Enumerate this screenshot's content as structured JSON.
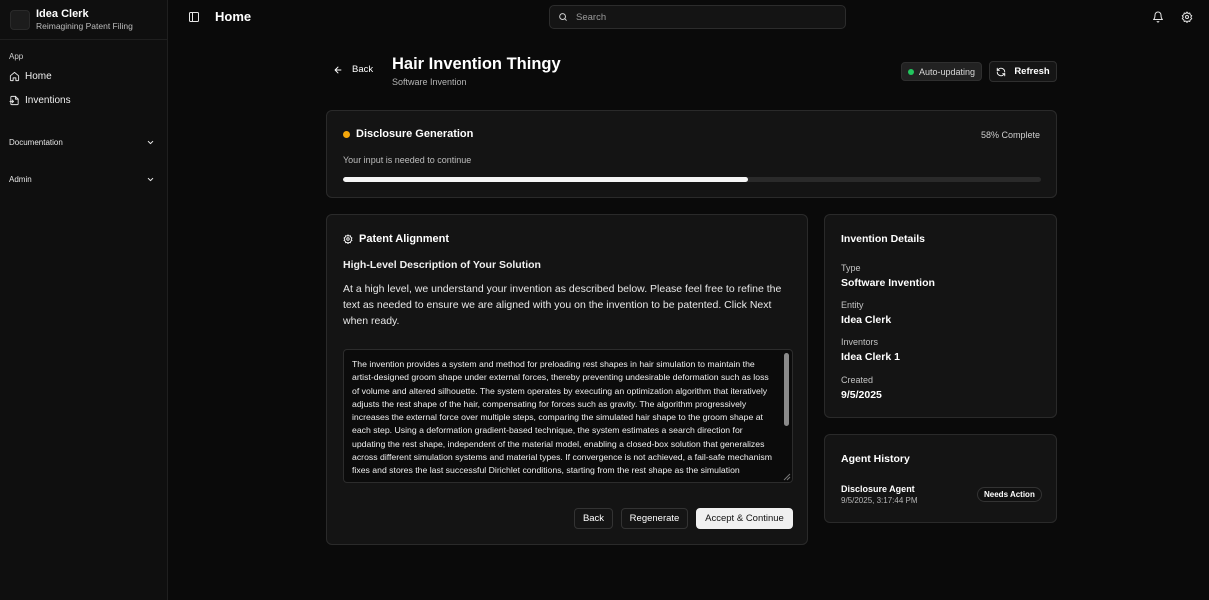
{
  "sidebar": {
    "brand_title": "Idea Clerk",
    "brand_subtitle": "Reimagining Patent Filing",
    "group_app": "App",
    "items": [
      {
        "label": "Home",
        "icon": "home-icon"
      },
      {
        "label": "Inventions",
        "icon": "file-import-icon"
      }
    ],
    "documentation": "Documentation",
    "admin": "Admin"
  },
  "topbar": {
    "title": "Home",
    "search_placeholder": "Search"
  },
  "header": {
    "back_label": "Back",
    "title": "Hair Invention Thingy",
    "subtitle": "Software Invention",
    "status_label": "Auto-updating",
    "status_color": "#22c55e",
    "refresh_label": "Refresh"
  },
  "progress": {
    "title": "Disclosure Generation",
    "percent_label": "58% Complete",
    "percent": 58,
    "message": "Your input is needed to continue",
    "dot_color": "#f5a70b"
  },
  "alignment": {
    "title": "Patent Alignment",
    "subtitle": "High-Level Description of Your Solution",
    "description": "At a high level, we understand your invention as described below. Please feel free to refine the text as needed to ensure we are aligned with you on the invention to be patented. Click Next when ready.",
    "text": "The invention provides a system and method for preloading rest shapes in hair simulation to maintain the artist-designed groom shape under external forces, thereby preventing undesirable deformation such as loss of volume and altered silhouette. The system operates by executing an optimization algorithm that iteratively adjusts the rest shape of the hair, compensating for forces such as gravity. The algorithm progressively increases the external force over multiple steps, comparing the simulated hair shape to the groom shape at each step. Using a deformation gradient-based technique, the system estimates a search direction for updating the rest shape, independent of the material model, enabling a closed-box solution that generalizes across different simulation systems and material types. If convergence is not achieved, a fail-safe mechanism fixes and stores the last successful Dirichlet conditions, starting from the rest shape as the simulation",
    "back_label": "Back",
    "regenerate_label": "Regenerate",
    "accept_label": "Accept & Continue"
  },
  "details": {
    "title": "Invention Details",
    "fields": [
      {
        "label": "Type",
        "value": "Software Invention"
      },
      {
        "label": "Entity",
        "value": "Idea Clerk"
      },
      {
        "label": "Inventors",
        "value": "Idea Clerk 1"
      },
      {
        "label": "Created",
        "value": "9/5/2025"
      }
    ]
  },
  "history": {
    "title": "Agent History",
    "agent": "Disclosure Agent",
    "time": "9/5/2025, 3:17:44 PM",
    "badge": "Needs Action"
  }
}
